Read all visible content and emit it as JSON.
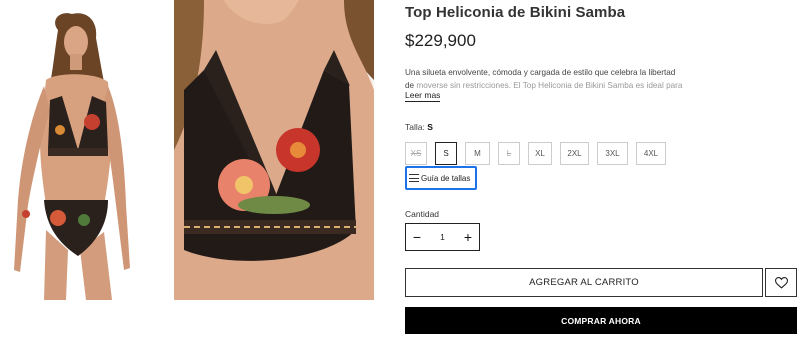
{
  "product": {
    "title": "Top Heliconia de Bikini Samba",
    "price": "$229,900",
    "description_visible": "Una silueta envolvente, cómoda y cargada de estilo que celebra la libertad de",
    "description_faded": "moverse sin restricciones. El Top Heliconia de Bikini Samba es ideal para quienes",
    "read_more": "Leer mas"
  },
  "size": {
    "label": "Talla:",
    "selected": "S",
    "options": [
      {
        "label": "XS",
        "available": false
      },
      {
        "label": "S",
        "available": true,
        "selected": true
      },
      {
        "label": "M",
        "available": true
      },
      {
        "label": "L",
        "available": false
      },
      {
        "label": "XL",
        "available": true
      },
      {
        "label": "2XL",
        "available": true
      },
      {
        "label": "3XL",
        "available": true
      },
      {
        "label": "4XL",
        "available": true
      }
    ],
    "guide": "Guía de tallas"
  },
  "quantity": {
    "label": "Cantidad",
    "value": "1",
    "minus": "−",
    "plus": "+"
  },
  "actions": {
    "add_to_cart": "AGREGAR AL CARRITO",
    "buy_now": "COMPRAR AHORA"
  },
  "colors": {
    "accent_focus": "#1a73e8",
    "buy_bg": "#000000"
  },
  "icons": {
    "guide": "ruler-lines-icon",
    "wishlist": "heart-icon"
  }
}
